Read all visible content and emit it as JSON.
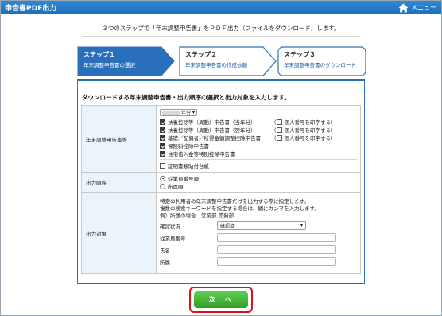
{
  "app": {
    "title": "申告書PDF出力",
    "menu_label": "メニュー"
  },
  "intro": "３つのステップで「年末調整申告書」をＰＤＦ出力（ファイルをダウンロード）します。",
  "steps": [
    {
      "title": "ステップ１",
      "subtitle": "年末調整申告書の選択",
      "active": true
    },
    {
      "title": "ステップ２",
      "subtitle": "年末調整申告書の作成依頼",
      "active": false
    },
    {
      "title": "ステップ３",
      "subtitle": "年末調整申告書のダウンロード",
      "active": false
    }
  ],
  "panel": {
    "heading": "ダウンロードする年末調整申告書・出力順序の選択と出力対象を入力します。",
    "forms_label": "年末調整申告書等",
    "year_suffix": "年分",
    "items": [
      {
        "label": "扶養控除等（異動）申告書（当年分）",
        "checked": true,
        "option": "個人番号を印字する",
        "option_checked": false
      },
      {
        "label": "扶養控除等（異動）申告書（翌年分）",
        "checked": true,
        "option": "個人番号を印字する",
        "option_checked": false
      },
      {
        "label": "基礎／配偶者／所得金額調整控除申告書",
        "checked": true,
        "option": "個人番号を印字する",
        "option_checked": false
      },
      {
        "label": "保険料控除申告書",
        "checked": true
      },
      {
        "label": "住宅借入金等特別控除申告書",
        "checked": true
      }
    ],
    "attach_label": "証明書類貼付台紙",
    "attach_checked": false,
    "order_label": "出力順序",
    "order_options": [
      {
        "label": "従業員番号順",
        "selected": true
      },
      {
        "label": "所属順",
        "selected": false
      }
    ],
    "target_label": "出力対象",
    "target_notes": [
      "特定の利用者の年末調整申告書だけを出力する際に指定します。",
      "複数の検索キーワードを指定する場合は、間にカンマを入力します。",
      "例）所属の場合　営業部,開発部"
    ],
    "status_label": "確認状況",
    "status_value": "確認済",
    "emp_no_label": "従業員番号",
    "emp_no_value": "",
    "name_label": "氏名",
    "name_value": "",
    "dept_label": "所属",
    "dept_value": ""
  },
  "next_button": "次　へ",
  "colors": {
    "titlebar": "#2479c4",
    "step_active": "#2a6fbc",
    "step_border": "#2d6fb4",
    "next_button": "#3caf31",
    "highlight": "#d8141b"
  }
}
